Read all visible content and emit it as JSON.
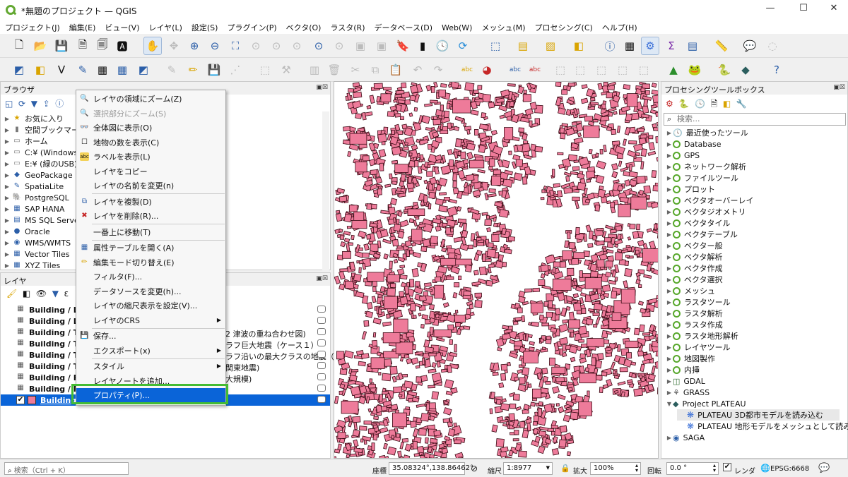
{
  "window": {
    "title": "*無題のプロジェクト — QGIS",
    "minimize": "—",
    "maximize": "☐",
    "close": "✕"
  },
  "menu": [
    "プロジェクト(J)",
    "編集(E)",
    "ビュー(V)",
    "レイヤ(L)",
    "設定(S)",
    "プラグイン(P)",
    "ベクタ(O)",
    "ラスタ(R)",
    "データベース(D)",
    "Web(W)",
    "メッシュ(M)",
    "プロセシング(C)",
    "ヘルプ(H)"
  ],
  "browser": {
    "title": "ブラウザ",
    "items": [
      {
        "label": "お気に入り",
        "icon": "★"
      },
      {
        "label": "空間ブックマーク",
        "icon": "▮"
      },
      {
        "label": "ホーム",
        "icon": "▭"
      },
      {
        "label": "C:¥ (Windows)",
        "icon": "▭"
      },
      {
        "label": "E:¥ (緑のUSB)",
        "icon": "▭"
      },
      {
        "label": "GeoPackage",
        "icon": "◆"
      },
      {
        "label": "SpatiaLite",
        "icon": "✎"
      },
      {
        "label": "PostgreSQL",
        "icon": "🐘"
      },
      {
        "label": "SAP HANA",
        "icon": "▦"
      },
      {
        "label": "MS SQL Server",
        "icon": "▤"
      },
      {
        "label": "Oracle",
        "icon": "●"
      },
      {
        "label": "WMS/WMTS",
        "icon": "◉"
      },
      {
        "label": "Vector Tiles",
        "icon": "▦"
      },
      {
        "label": "XYZ Tiles",
        "icon": "▦"
      }
    ]
  },
  "layers": {
    "title": "レイヤ",
    "rows": [
      {
        "name": "Building / Lan"
      },
      {
        "name": "Building / Lan"
      },
      {
        "name": "Building / Tsu",
        "suffix": "2 津波の重ね合わせ図)"
      },
      {
        "name": "Building / Tsu",
        "suffix": "ラフ巨大地震（ケース１）"
      },
      {
        "name": "Building / Tsu",
        "suffix": "ラフ沿いの最大クラスの地震（"
      },
      {
        "name": "Building / Tsu",
        "suffix": "関東地震)"
      },
      {
        "name": "Building / Rive",
        "suffix": "大規模)"
      },
      {
        "name": "Building / Rive",
        "suffix": ")"
      },
      {
        "name": "Building",
        "checked": "✔"
      }
    ]
  },
  "context_menu": {
    "items": [
      {
        "label": "レイヤの領域にズーム(Z)",
        "icon": "🔍"
      },
      {
        "label": "選択部分にズーム(S)",
        "icon": "🔍",
        "disabled": true
      },
      {
        "label": "全体図に表示(O)",
        "icon": "👓"
      },
      {
        "label": "地物の数を表示(C)",
        "icon": "☐"
      },
      {
        "label": "ラベルを表示(L)",
        "icon": "abc"
      },
      {
        "label": "レイヤをコピー",
        "icon": ""
      },
      {
        "label": "レイヤの名前を変更(n)",
        "icon": ""
      },
      {
        "label": "レイヤを複製(D)",
        "icon": "⧉"
      },
      {
        "label": "レイヤを削除(R)...",
        "icon": "✖"
      },
      {
        "label": "一番上に移動(T)",
        "icon": ""
      },
      {
        "label": "属性テーブルを開く(A)",
        "icon": "▦"
      },
      {
        "label": "編集モード切り替え(E)",
        "icon": "✏"
      },
      {
        "label": "フィルタ(F)...",
        "icon": ""
      },
      {
        "label": "データソースを変更(h)...",
        "icon": ""
      },
      {
        "label": "レイヤの縮尺表示を設定(V)...",
        "icon": ""
      },
      {
        "label": "レイヤのCRS",
        "icon": ""
      },
      {
        "label": "保存...",
        "icon": "💾"
      },
      {
        "label": "エクスポート(x)",
        "icon": ""
      },
      {
        "label": "スタイル",
        "icon": ""
      },
      {
        "label": "レイヤノートを追加...",
        "icon": ""
      },
      {
        "label": "プロパティ(P)...",
        "icon": ""
      }
    ]
  },
  "processing": {
    "title": "プロセシングツールボックス",
    "search_placeholder": "検索...",
    "items": [
      {
        "label": "最近使ったツール",
        "kind": "clock"
      },
      {
        "label": "Database",
        "kind": "q"
      },
      {
        "label": "GPS",
        "kind": "q"
      },
      {
        "label": "ネットワーク解析",
        "kind": "q"
      },
      {
        "label": "ファイルツール",
        "kind": "q"
      },
      {
        "label": "プロット",
        "kind": "q"
      },
      {
        "label": "ベクタオーバーレイ",
        "kind": "q"
      },
      {
        "label": "ベクタジオメトリ",
        "kind": "q"
      },
      {
        "label": "ベクタタイル",
        "kind": "q"
      },
      {
        "label": "ベクタテーブル",
        "kind": "q"
      },
      {
        "label": "ベクター般",
        "kind": "q"
      },
      {
        "label": "ベクタ解析",
        "kind": "q"
      },
      {
        "label": "ベクタ作成",
        "kind": "q"
      },
      {
        "label": "ベクタ選択",
        "kind": "q"
      },
      {
        "label": "メッシュ",
        "kind": "q"
      },
      {
        "label": "ラスタツール",
        "kind": "q"
      },
      {
        "label": "ラスタ解析",
        "kind": "q"
      },
      {
        "label": "ラスタ作成",
        "kind": "q"
      },
      {
        "label": "ラスタ地形解析",
        "kind": "q"
      },
      {
        "label": "レイヤツール",
        "kind": "q"
      },
      {
        "label": "地図製作",
        "kind": "q"
      },
      {
        "label": "内挿",
        "kind": "q"
      },
      {
        "label": "GDAL",
        "kind": "gdal"
      },
      {
        "label": "GRASS",
        "kind": "grass"
      },
      {
        "label": "Project PLATEAU",
        "kind": "cube",
        "expanded": true
      },
      {
        "label": "PLATEAU 3D都市モデルを読み込む",
        "kind": "gear",
        "child": true
      },
      {
        "label": "PLATEAU 地形モデルをメッシュとして読み込む",
        "kind": "gear",
        "child": true
      },
      {
        "label": "SAGA",
        "kind": "saga"
      }
    ]
  },
  "status": {
    "search_placeholder": "検索（Ctrl + K）",
    "coord_label": "座標",
    "coord_value": "35.08324°,138.86462°",
    "scale_label": "縮尺",
    "scale_value": "1:8977",
    "zoom_label": "拡大",
    "zoom_value": "100%",
    "rotation_label": "回転",
    "rotation_value": "0.0 °",
    "render_label": "レンダ",
    "crs": "EPSG:6668"
  },
  "colors": {
    "building_fill": "#ee7b9a",
    "building_stroke": "#3a0a14",
    "highlight": "#0a64d8",
    "callout": "#44bb33"
  }
}
